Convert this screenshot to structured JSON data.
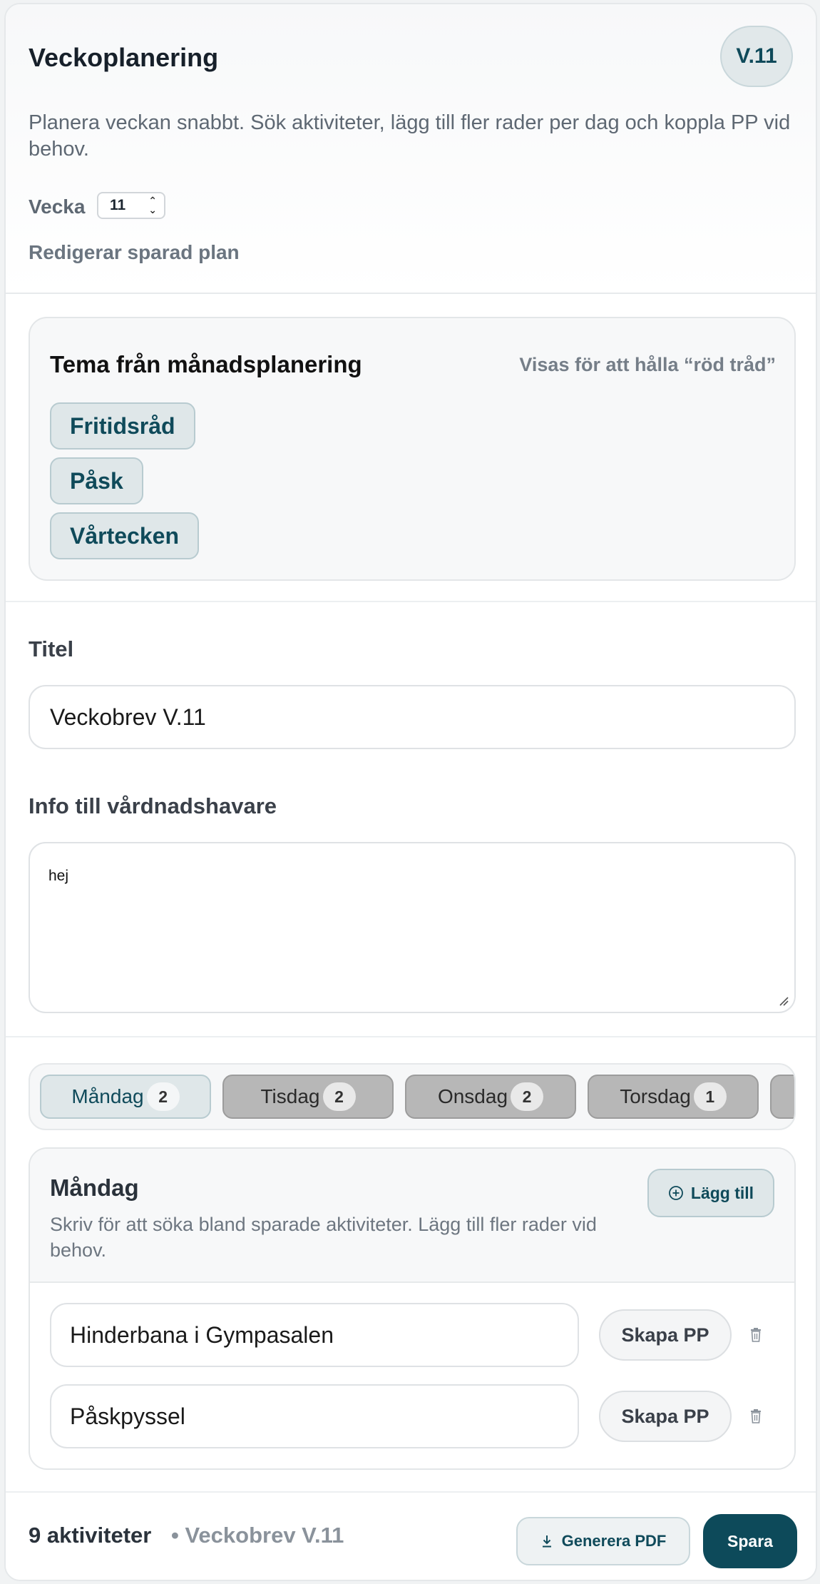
{
  "header": {
    "title": "Veckoplanering",
    "version_badge": "V.11",
    "intro": "Planera veckan snabbt. Sök aktiviteter, lägg till fler rader per dag och koppla PP vid behov.",
    "week_label": "Vecka",
    "week_value": "11",
    "edit_status": "Redigerar sparad plan"
  },
  "theme": {
    "title": "Tema från månadsplanering",
    "hint": "Visas för att hålla “röd tråd”",
    "chips": [
      "Fritidsråd",
      "Påsk",
      "Vårtecken"
    ]
  },
  "form": {
    "title_label": "Titel",
    "title_value": "Veckobrev V.11",
    "info_label": "Info till vårdnadshavare",
    "info_value": "hej"
  },
  "days": {
    "tabs": [
      {
        "label": "Måndag",
        "count": "2",
        "active": true
      },
      {
        "label": "Tisdag",
        "count": "2",
        "active": false
      },
      {
        "label": "Onsdag",
        "count": "2",
        "active": false
      },
      {
        "label": "Torsdag",
        "count": "1",
        "active": false
      }
    ]
  },
  "day_panel": {
    "title": "Måndag",
    "hint": "Skriv för att söka bland sparade aktiviteter. Lägg till fler rader vid behov.",
    "add_label": "Lägg till",
    "pp_label": "Skapa PP",
    "activities": [
      "Hinderbana i Gympasalen",
      "Påskpyssel"
    ]
  },
  "footer": {
    "count": "9 aktiviteter",
    "title": "• Veckobrev V.11",
    "pdf_label": "Generera PDF",
    "save_label": "Spara"
  },
  "colors": {
    "accent": "#0d4a5a",
    "chip_bg": "#dfe7e9",
    "inactive_tab": "#b7b7b7"
  }
}
